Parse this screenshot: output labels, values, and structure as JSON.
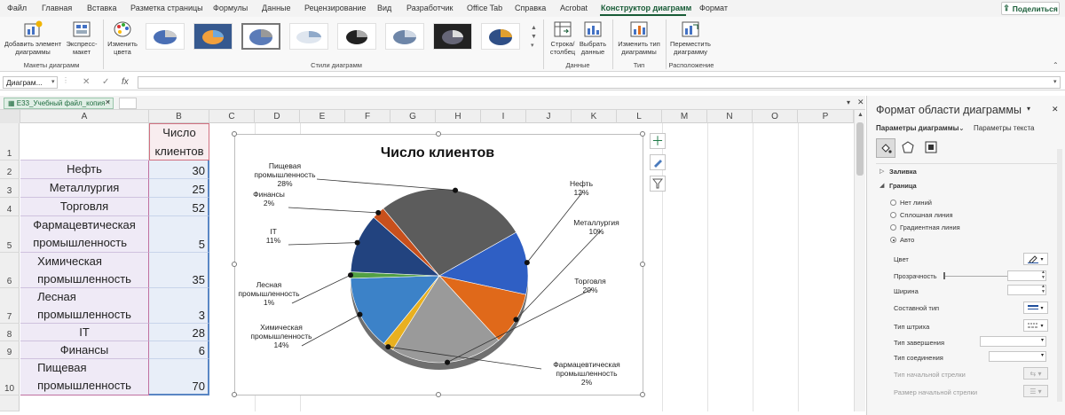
{
  "menu": {
    "tabs": [
      "Файл",
      "Главная",
      "Вставка",
      "Разметка страницы",
      "Формулы",
      "Данные",
      "Рецензирование",
      "Вид",
      "Разработчик",
      "Office Tab",
      "Справка",
      "Acrobat",
      "Конструктор диаграмм",
      "Формат"
    ],
    "active_tab": "Конструктор диаграмм",
    "share": "Поделиться"
  },
  "ribbon": {
    "add_element": "Добавить элемент\nдиаграммы",
    "express_layout": "Экспресс-\nмакет",
    "layouts_group": "Макеты диаграмм",
    "change_colors": "Изменить\nцвета",
    "styles_group": "Стили диаграмм",
    "row_col": "Строка/\nстолбец",
    "select_data": "Выбрать\nданные",
    "data_group": "Данные",
    "change_type": "Изменить тип\nдиаграммы",
    "type_group": "Тип",
    "move_chart": "Переместить\nдиаграмму",
    "location_group": "Расположение"
  },
  "formula_bar": {
    "name_box": "Диаграм...",
    "fx": "fx",
    "cancel": "✕",
    "confirm": "✓"
  },
  "sheet": {
    "file_tab": "E33_Учебный файл_копия *",
    "columns": [
      "A",
      "B",
      "C",
      "D",
      "E",
      "F",
      "G",
      "H",
      "I",
      "J",
      "K",
      "L",
      "M",
      "N",
      "O",
      "P"
    ],
    "rows": [
      {
        "num": "1",
        "a": "",
        "b": "Число\nклиентов"
      },
      {
        "num": "2",
        "a": "Нефть",
        "b": "30"
      },
      {
        "num": "3",
        "a": "Металлургия",
        "b": "25"
      },
      {
        "num": "4",
        "a": "Торговля",
        "b": "52"
      },
      {
        "num": "5",
        "a": "Фармацевтическая\nпромышленность",
        "b": "5"
      },
      {
        "num": "6",
        "a": "Химическая\nпромышленность",
        "b": "35"
      },
      {
        "num": "7",
        "a": "Лесная\nпромышленность",
        "b": "3"
      },
      {
        "num": "8",
        "a": "IT",
        "b": "28"
      },
      {
        "num": "9",
        "a": "Финансы",
        "b": "6"
      },
      {
        "num": "10",
        "a": "Пищевая\nпромышленность",
        "b": "70"
      }
    ]
  },
  "chart_data": {
    "type": "pie",
    "title": "Число клиентов",
    "categories": [
      "Нефть",
      "Металлургия",
      "Торговля",
      "Фармацевтическая промышленность",
      "Химическая промышленность",
      "Лесная промышленность",
      "IT",
      "Финансы",
      "Пищевая промышленность"
    ],
    "values": [
      30,
      25,
      52,
      5,
      35,
      3,
      28,
      6,
      70
    ],
    "labels": [
      {
        "name": "Нефть",
        "pct": "12%"
      },
      {
        "name": "Металлургия",
        "pct": "10%"
      },
      {
        "name": "Торговля",
        "pct": "20%"
      },
      {
        "name": "Фармацевтическая промышленность",
        "pct": "2%"
      },
      {
        "name": "Химическая промышленность",
        "pct": "14%"
      },
      {
        "name": "Лесная промышленность",
        "pct": "1%"
      },
      {
        "name": "IT",
        "pct": "11%"
      },
      {
        "name": "Финансы",
        "pct": "2%"
      },
      {
        "name": "Пищевая промышленность",
        "pct": "28%"
      }
    ],
    "colors": [
      "#2f5fc4",
      "#e0691a",
      "#9a9a9a",
      "#e8b020",
      "#3c82c8",
      "#52a044",
      "#22437f",
      "#c8501c",
      "#5c5c5c"
    ]
  },
  "format_pane": {
    "title": "Формат области диаграммы",
    "tab_chart": "Параметры диаграммы",
    "tab_text": "Параметры текста",
    "fill": "Заливка",
    "border": "Граница",
    "radio": [
      "Нет линий",
      "Сплошная линия",
      "Градиентная линия",
      "Авто"
    ],
    "selected_radio": "Авто",
    "props": [
      "Цвет",
      "Прозрачность",
      "Ширина",
      "Составной тип",
      "Тип штриха",
      "Тип завершения",
      "Тип соединения",
      "Тип начальной стрелки",
      "Размер начальной стрелки"
    ]
  }
}
